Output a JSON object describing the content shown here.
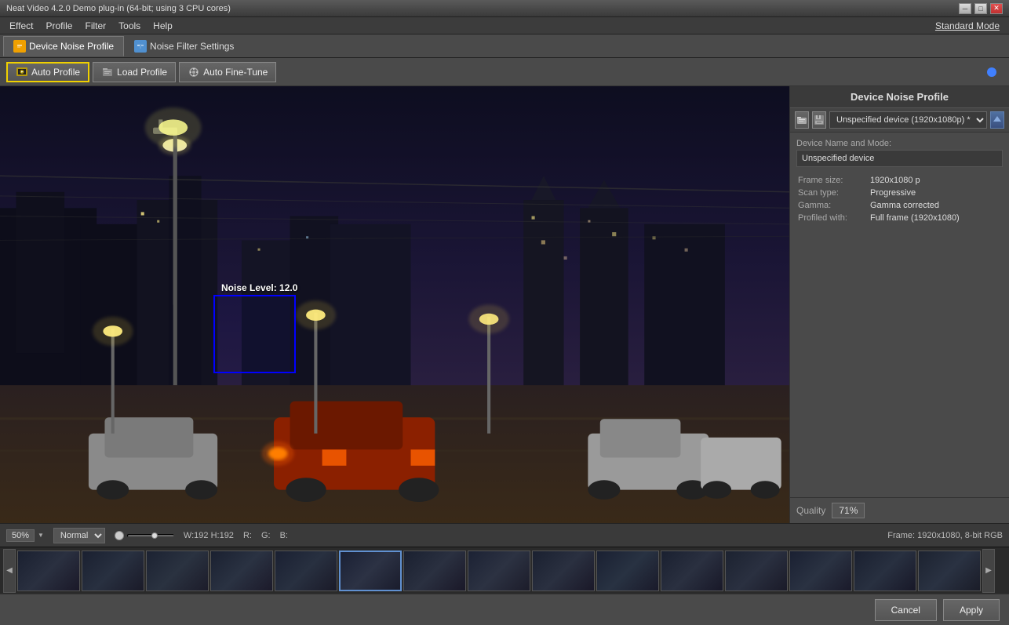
{
  "titleBar": {
    "title": "Neat Video 4.2.0 Demo plug-in (64-bit; using 3 CPU cores)",
    "controls": [
      "minimize",
      "maximize",
      "close"
    ]
  },
  "menuBar": {
    "items": [
      "Effect",
      "Profile",
      "Filter",
      "Tools",
      "Help"
    ],
    "standardMode": "Standard Mode"
  },
  "tabs": [
    {
      "id": "device",
      "label": "Device Noise Profile",
      "active": true
    },
    {
      "id": "filter",
      "label": "Noise Filter Settings",
      "active": false
    }
  ],
  "toolbar": {
    "autoProfile": "Auto Profile",
    "loadProfile": "Load Profile",
    "autoFineTune": "Auto Fine-Tune"
  },
  "videoArea": {
    "noiseLabel": "Noise Level: 12.0",
    "frameInfo": "Frame: 1920x1080, 8-bit RGB",
    "dimensions": "W:192 H:192",
    "zoom": "50%",
    "mode": "Normal",
    "channels": {
      "r": "R:",
      "g": "G:",
      "b": "B:"
    }
  },
  "rightPanel": {
    "header": "Device Noise Profile",
    "deviceDropdown": "Unspecified device (1920x1080p) *",
    "deviceNameLabel": "Device Name and Mode:",
    "deviceName": "Unspecified device",
    "frameSize": "1920x1080 p",
    "scanType": "Progressive",
    "gamma": "Gamma corrected",
    "profiledWith": "Full frame (1920x1080)",
    "frameSizeLabel": "Frame size:",
    "scanTypeLabel": "Scan type:",
    "gammaLabel": "Gamma:",
    "profiledWithLabel": "Profiled with:",
    "qualityLabel": "Quality",
    "qualityValue": "71%"
  },
  "filmStrip": {
    "thumbCount": 15,
    "activeIndex": 5
  },
  "bottomBar": {
    "cancel": "Cancel",
    "apply": "Apply"
  }
}
